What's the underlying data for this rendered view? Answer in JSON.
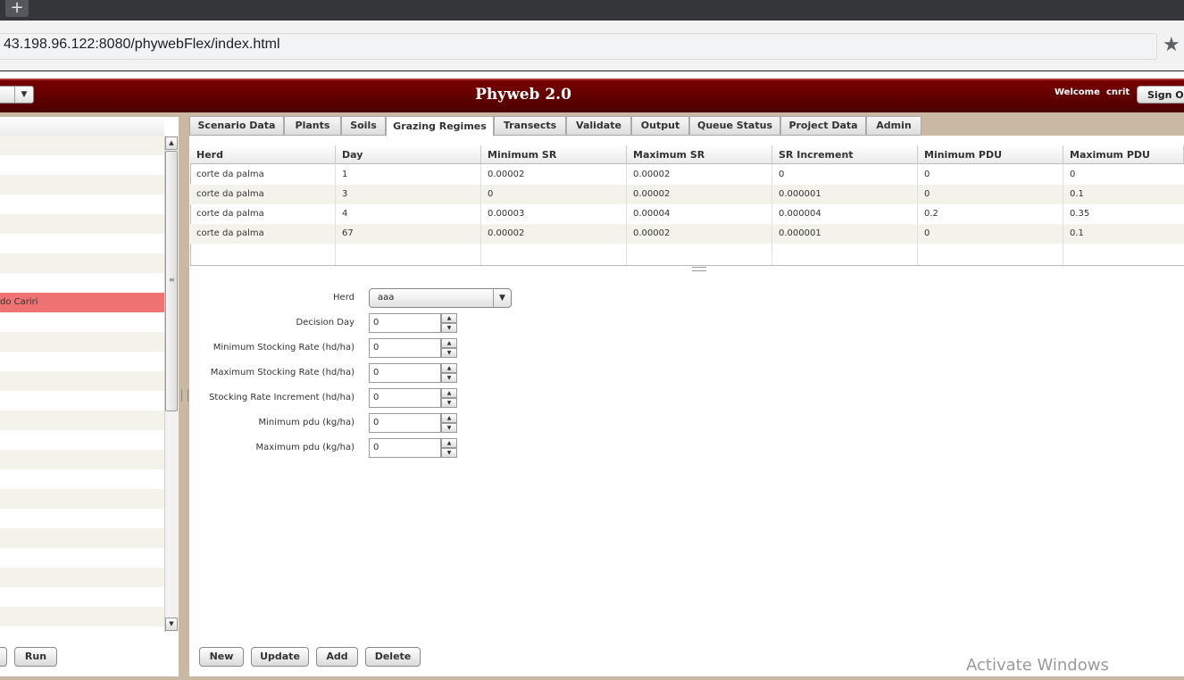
{
  "browser": {
    "new_tab_symbol": "+",
    "url": "43.198.96.122:8080/phywebFlex/index.html",
    "star_icon": "star-icon"
  },
  "header": {
    "title": "Phyweb 2.0",
    "welcome": "Welcome",
    "username": "cnrit",
    "sign_out": "Sign Out"
  },
  "left": {
    "selected_item": "do Cariri",
    "run_label": "Run"
  },
  "tabs": [
    {
      "label": "Scenario Data"
    },
    {
      "label": "Plants"
    },
    {
      "label": "Soils"
    },
    {
      "label": "Grazing Regimes",
      "active": true
    },
    {
      "label": "Transects"
    },
    {
      "label": "Validate"
    },
    {
      "label": "Output"
    },
    {
      "label": "Queue Status"
    },
    {
      "label": "Project Data"
    },
    {
      "label": "Admin"
    }
  ],
  "grid": {
    "columns": [
      "Herd",
      "Day",
      "Minimum SR",
      "Maximum SR",
      "SR Increment",
      "Minimum PDU",
      "Maximum PDU"
    ],
    "rows": [
      [
        "corte da palma",
        "1",
        "0.00002",
        "0.00002",
        "0",
        "0",
        "0"
      ],
      [
        "corte da palma",
        "3",
        "0",
        "0.00002",
        "0.000001",
        "0",
        "0.1"
      ],
      [
        "corte da palma",
        "4",
        "0.00003",
        "0.00004",
        "0.000004",
        "0.2",
        "0.35"
      ],
      [
        "corte da palma",
        "67",
        "0.00002",
        "0.00002",
        "0.000001",
        "0",
        "0.1"
      ]
    ]
  },
  "form": {
    "herd_label": "Herd",
    "herd_value": "aaa",
    "fields": [
      {
        "label": "Decision Day",
        "value": "0"
      },
      {
        "label": "Minimum Stocking Rate (hd/ha)",
        "value": "0"
      },
      {
        "label": "Maximum Stocking Rate (hd/ha)",
        "value": "0"
      },
      {
        "label": "Stocking Rate Increment (hd/ha)",
        "value": "0"
      },
      {
        "label": "Minimum pdu (kg/ha)",
        "value": "0"
      },
      {
        "label": "Maximum pdu (kg/ha)",
        "value": "0"
      }
    ]
  },
  "actions": {
    "new": "New",
    "update": "Update",
    "add": "Add",
    "delete": "Delete"
  },
  "watermark": "Activate Windows"
}
